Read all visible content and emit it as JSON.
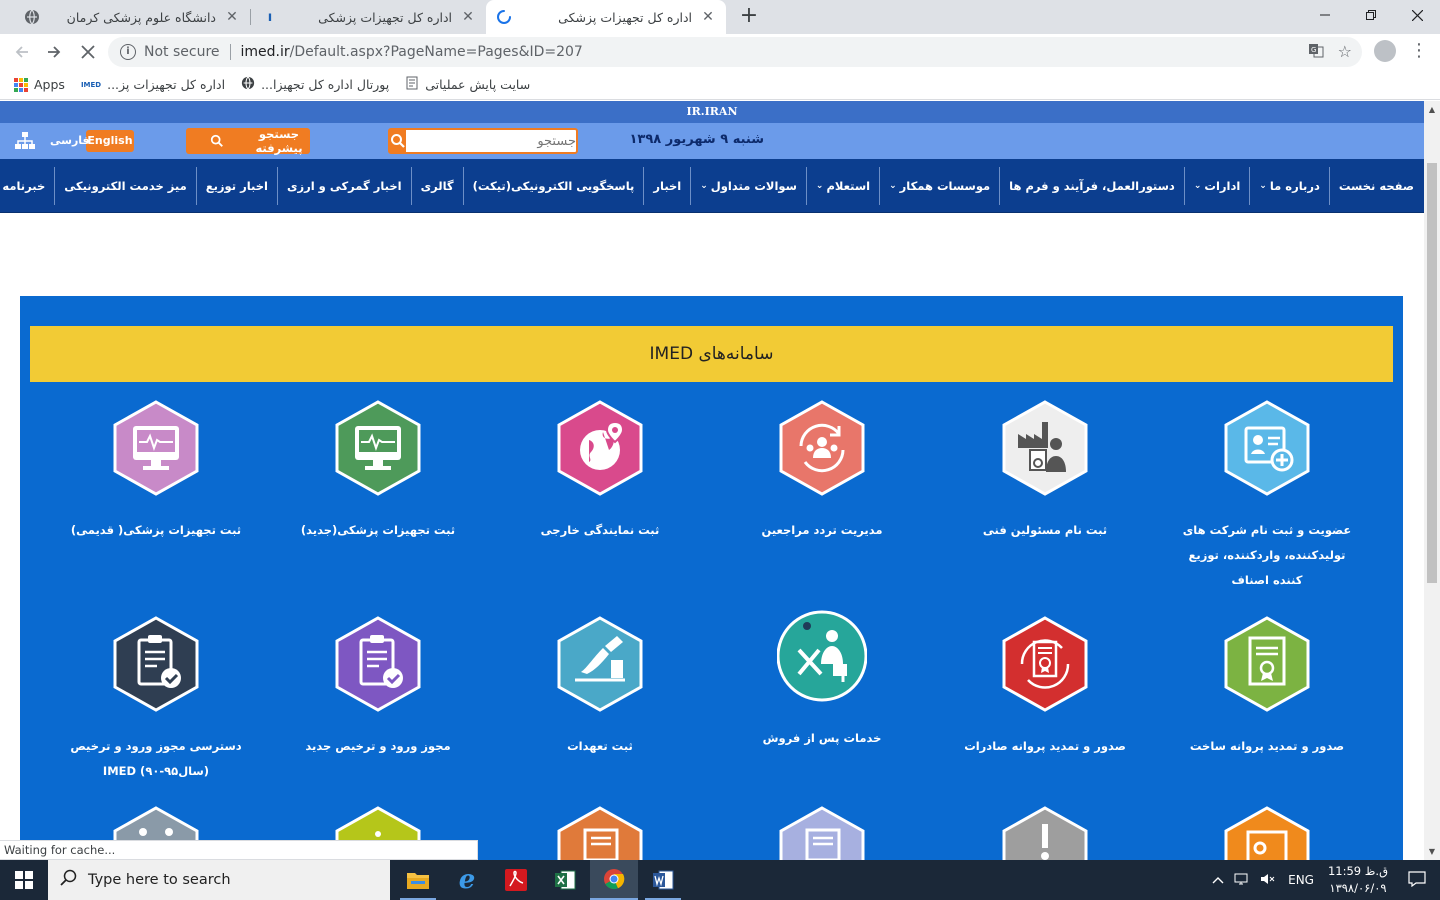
{
  "browser": {
    "tabs": [
      {
        "title": "دانشگاه علوم پزشکی کرمان",
        "active": false
      },
      {
        "title": "اداره کل تجهیزات پزشکی",
        "active": false
      },
      {
        "title": "اداره کل تجهیزات پزشکی",
        "active": true
      }
    ],
    "new_tab": "+",
    "url": {
      "security": "Not secure",
      "host": "imed.ir",
      "path": "/Default.aspx?PageName=Pages&ID=207"
    },
    "bookmarks": [
      {
        "label": "Apps",
        "icon": "apps-grid-icon"
      },
      {
        "label": "اداره کل تجهیزات پز...",
        "icon": "imed-favicon"
      },
      {
        "label": "پورتال اداره کل تجهیزا...",
        "icon": "globe-icon"
      },
      {
        "label": "سایت پایش عملیاتی",
        "icon": "page-icon"
      }
    ],
    "status_text": "Waiting for cache..."
  },
  "site": {
    "top_strip": "IR.IRAN",
    "date": "شنبه ۹ شهریور ۱۳۹۸",
    "search_placeholder": "جستجو",
    "advanced_search": "جستجو پیشرفته",
    "lang_en": "English",
    "lang_fa": "فارسی",
    "nav": [
      {
        "label": "صفحه نخست",
        "dropdown": false
      },
      {
        "label": "درباره ما",
        "dropdown": true
      },
      {
        "label": "ادارات",
        "dropdown": true
      },
      {
        "label": "دستورالعمل، فرآیند و فرم ها",
        "dropdown": false
      },
      {
        "label": "موسسات همکار",
        "dropdown": true
      },
      {
        "label": "استعلام",
        "dropdown": true
      },
      {
        "label": "سوالات متداول",
        "dropdown": true
      },
      {
        "label": "اخبار",
        "dropdown": false
      },
      {
        "label": "پاسخگویی الکترونیکی(تیکت)",
        "dropdown": false
      },
      {
        "label": "گالری",
        "dropdown": false
      },
      {
        "label": "اخبار گمرکی و ارزی",
        "dropdown": false
      },
      {
        "label": "اخبار توزیع",
        "dropdown": false
      },
      {
        "label": "میز خدمت الکترونیکی",
        "dropdown": false
      },
      {
        "label": "خبرنامه",
        "dropdown": false
      }
    ],
    "systems_title": "سامانه‌های IMED",
    "tiles_row1": [
      {
        "label": "عضویت و ثبت نام شرکت های تولیدکننده، واردکننده، توزیع کننده اصناف",
        "color": "#5ab8e8",
        "icon": "id-card-add-icon"
      },
      {
        "label": "ثبت نام مسئولین فنی",
        "color": "#e8e8e8",
        "icon": "factory-worker-icon"
      },
      {
        "label": "مدیریت تردد مراجعین",
        "color": "#e8766a",
        "icon": "people-cycle-icon"
      },
      {
        "label": "ثبت نمایندگی خارجی",
        "color": "#d94a8c",
        "icon": "globe-pin-icon"
      },
      {
        "label": "ثبت تجهیزات پزشکی(جدید)",
        "color": "#4e9a5a",
        "icon": "monitor-ecg-icon"
      },
      {
        "label": "ثبت تجهیزات پزشکی( قدیمی)",
        "color": "#c88ac8",
        "icon": "monitor-ecg-icon"
      }
    ],
    "tiles_row2": [
      {
        "label": "صدور و تمدید پروانه ساخت",
        "color": "#7cb342",
        "icon": "certificate-icon"
      },
      {
        "label": "صدور و تمدید پروانه صادرات",
        "color": "#d32f2f",
        "icon": "certificate-circle-icon"
      },
      {
        "label": "خدمات پس از فروش",
        "color": "#26a69a",
        "icon": "service-tools-icon"
      },
      {
        "label": "ثبت تعهدات",
        "color": "#4aa8c8",
        "icon": "signing-hand-icon"
      },
      {
        "label": "مجوز ورود و ترخیص جدید",
        "color": "#7e57c2",
        "icon": "clipboard-check-icon"
      },
      {
        "label": "دسترسی مجوز ورود و ترخیص (سال۹۵-۹۰) IMED",
        "color": "#2f3e52",
        "icon": "clipboard-check-icon"
      }
    ],
    "tiles_row3_colors": [
      "#f08a1c",
      "#9e9e9e",
      "#7986cb",
      "#e07a3a",
      "#b5c61a",
      "#8a9aa8"
    ]
  },
  "taskbar": {
    "search_placeholder": "Type here to search",
    "lang": "ENG",
    "time": "11:59 ق.ظ",
    "date": "۱۳۹۸/۰۶/۰۹"
  }
}
